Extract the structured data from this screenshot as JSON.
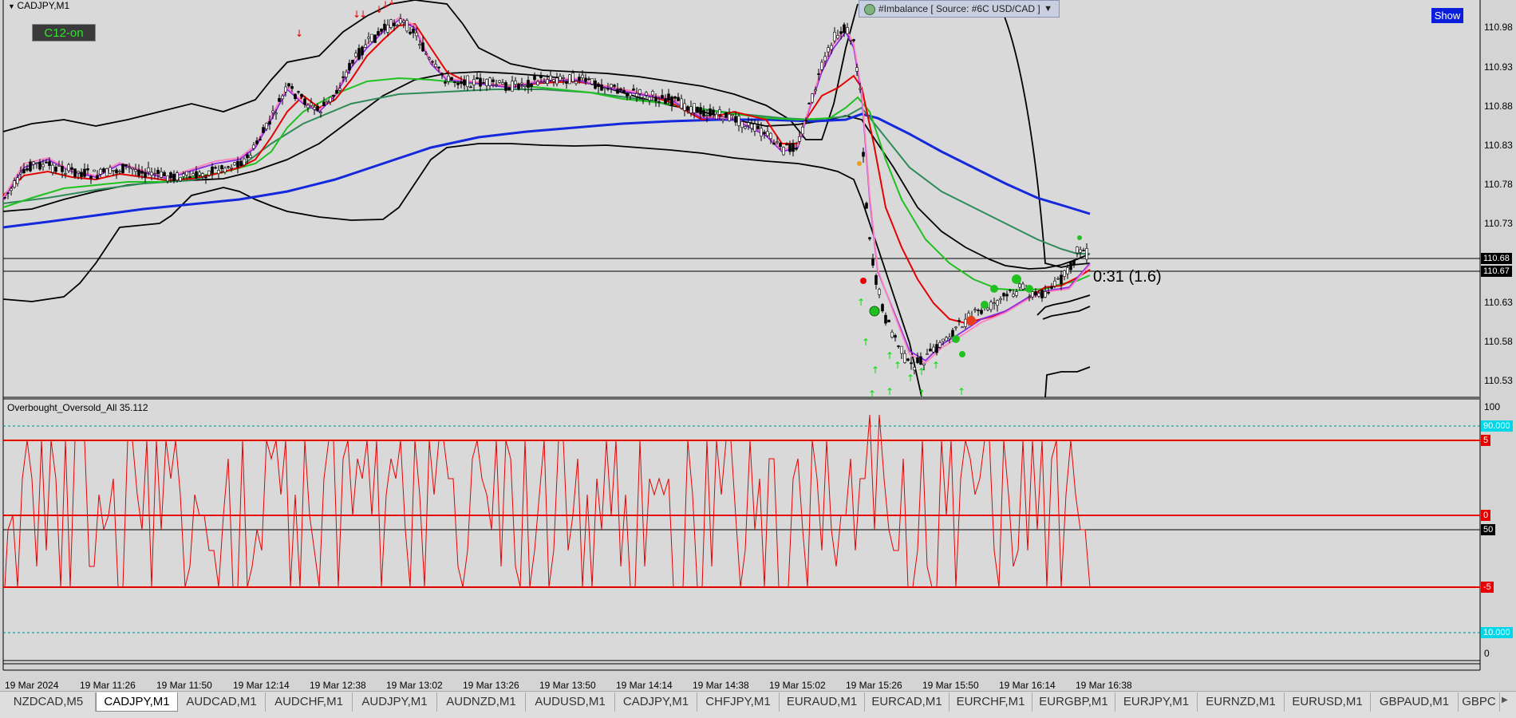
{
  "chart_header": {
    "symbol_title": "CADJPY,M1",
    "c12_button": "C12-on",
    "show_button": "Show",
    "imbalance_dropdown": "#Imbalance [ Source: #6C USD/CAD ]"
  },
  "countdown_label": "0:31 (1.6)",
  "oscillator_title": "Overbought_Oversold_All 35.112",
  "price_axis": {
    "ticks": [
      "110.98",
      "110.93",
      "110.88",
      "110.83",
      "110.78",
      "110.73",
      "110.63",
      "110.58",
      "110.53"
    ],
    "current_price_tags": [
      "110.68",
      "110.67"
    ]
  },
  "oscillator_axis": {
    "ticks": [
      "100",
      "0"
    ],
    "level_tags": [
      "90.000",
      "5",
      "0",
      "50",
      "-5",
      "10.000"
    ]
  },
  "time_axis": [
    "19 Mar 2024",
    "19 Mar 11:26",
    "19 Mar 11:50",
    "19 Mar 12:14",
    "19 Mar 12:38",
    "19 Mar 13:02",
    "19 Mar 13:26",
    "19 Mar 13:50",
    "19 Mar 14:14",
    "19 Mar 14:38",
    "19 Mar 15:02",
    "19 Mar 15:26",
    "19 Mar 15:50",
    "19 Mar 16:14",
    "19 Mar 16:38"
  ],
  "symbol_tabs": [
    "NZDCAD,M5",
    "CADJPY,M1",
    "AUDCAD,M1",
    "AUDCHF,M1",
    "AUDJPY,M1",
    "AUDNZD,M1",
    "AUDUSD,M1",
    "CADJPY,M1",
    "CHFJPY,M1",
    "EURAUD,M1",
    "EURCAD,M1",
    "EURCHF,M1",
    "EURGBP,M1",
    "EURJPY,M1",
    "EURNZD,M1",
    "EURUSD,M1",
    "GBPAUD,M1",
    "GBPC"
  ],
  "active_tab_index": 1,
  "colors": {
    "background": "#d9d9d9",
    "candles": "#000000",
    "ma_fast": "#e60000",
    "ma_pink": "#ff80c0",
    "ma_purple": "#8a2be2",
    "ma_green": "#20c020",
    "ma_darkgreen": "#2e8b57",
    "ma_slow": "#1428dc",
    "bands": "#000000",
    "oscillator": "#e60000",
    "level_lines": "#e60000",
    "dashed_levels": "#008b8b",
    "arrow_up": "#00ff00",
    "arrow_down": "#ff0000"
  },
  "chart_data": {
    "type": "line",
    "price_range": [
      110.51,
      111.01
    ],
    "oscillator_range": [
      -5,
      100
    ]
  }
}
